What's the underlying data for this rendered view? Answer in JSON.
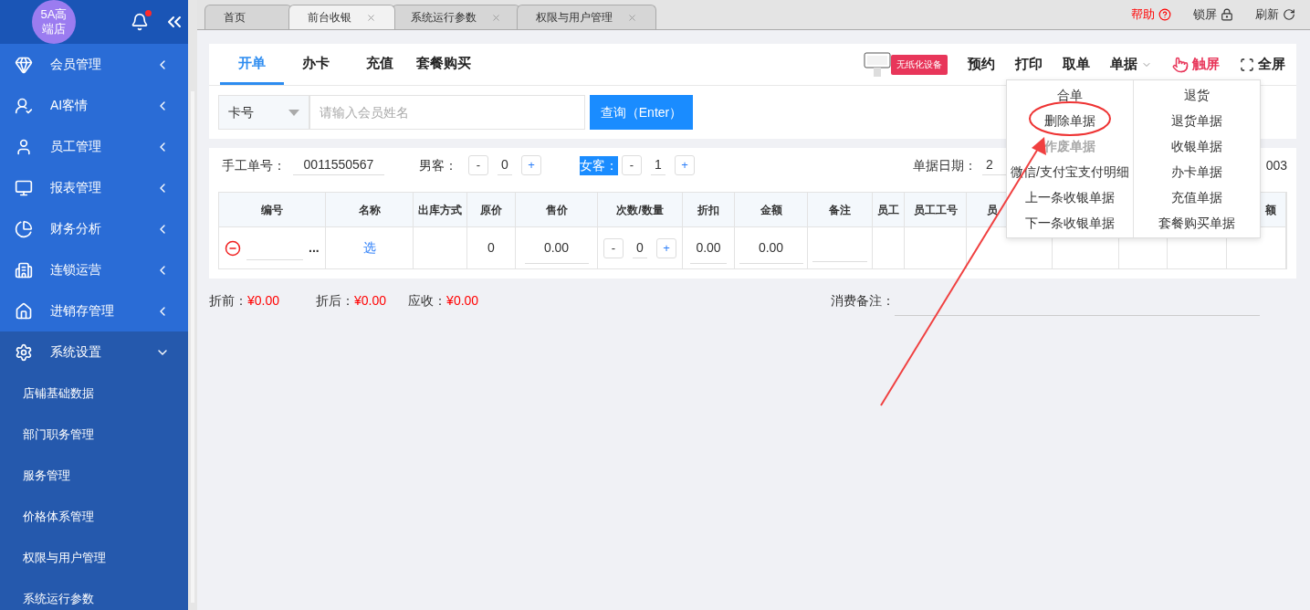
{
  "sidebar": {
    "store_badge": "5A高端店",
    "has_unread": true,
    "items": [
      {
        "label": "会员管理",
        "expanded": false
      },
      {
        "label": "AI客情",
        "expanded": false
      },
      {
        "label": "员工管理",
        "expanded": false
      },
      {
        "label": "报表管理",
        "expanded": false
      },
      {
        "label": "财务分析",
        "expanded": false
      },
      {
        "label": "连锁运营",
        "expanded": false
      },
      {
        "label": "进销存管理",
        "expanded": false
      },
      {
        "label": "系统设置",
        "expanded": true,
        "children": [
          "店铺基础数据",
          "部门职务管理",
          "服务管理",
          "价格体系管理",
          "权限与用户管理",
          "系统运行参数"
        ]
      }
    ]
  },
  "tabs": [
    {
      "label": "首页",
      "selected": false,
      "closable": false
    },
    {
      "label": "前台收银",
      "selected": true,
      "closable": true
    },
    {
      "label": "系统运行参数",
      "selected": false,
      "closable": true
    },
    {
      "label": "权限与用户管理",
      "selected": false,
      "closable": true
    }
  ],
  "header_actions": [
    {
      "label": "帮助",
      "kind": "help"
    },
    {
      "label": "锁屏",
      "kind": "lock"
    },
    {
      "label": "刷新",
      "kind": "refresh"
    }
  ],
  "page_tabs": [
    {
      "label": "开单",
      "selected": true
    },
    {
      "label": "办卡",
      "selected": false
    },
    {
      "label": "充值",
      "selected": false
    },
    {
      "label": "套餐购买",
      "selected": false
    }
  ],
  "paperless_badge": "无纸化设备",
  "toolbar": [
    {
      "label": "预约",
      "kind": "plain"
    },
    {
      "label": "打印",
      "kind": "plain"
    },
    {
      "label": "取单",
      "kind": "plain"
    },
    {
      "label": "单据",
      "kind": "dropdown"
    },
    {
      "label": "触屏",
      "kind": "touch"
    },
    {
      "label": "全屏",
      "kind": "fullscreen"
    }
  ],
  "search": {
    "select_value": "卡号",
    "placeholder": "请输入会员姓名",
    "button": "查询（Enter）"
  },
  "form": {
    "manual_no_label": "手工单号：",
    "manual_no": "0011550567",
    "male_label": "男客：",
    "male_count": "0",
    "female_label": "女客：",
    "female_highlighted": true,
    "female_count": "1",
    "stepper_minus": "-",
    "stepper_plus": "+",
    "date_label": "单据日期：",
    "date_value": "2",
    "trailing_text": "003"
  },
  "table": {
    "columns": [
      "编号",
      "名称",
      "出库方式",
      "原价",
      "售价",
      "次数/数量",
      "折扣",
      "金额",
      "备注",
      "员工",
      "员工工号",
      "员",
      "",
      "",
      "",
      "额"
    ],
    "row": {
      "pick_dots": "...",
      "name_link": "选",
      "original_price": "0",
      "sale_price": "0.00",
      "qty": "0",
      "qty_minus": "-",
      "qty_plus": "+",
      "discount": "0.00",
      "amount": "0.00"
    }
  },
  "totals": [
    {
      "label": "折前：",
      "value": "¥0.00"
    },
    {
      "label": "折后：",
      "value": "¥0.00"
    },
    {
      "label": "应收：",
      "value": "¥0.00"
    }
  ],
  "remark_label": "消费备注：",
  "dropdown": {
    "left": [
      {
        "label": "合单",
        "disabled": false
      },
      {
        "label": "删除单据",
        "disabled": false
      },
      {
        "label": "作废单据",
        "disabled": true
      },
      {
        "label": "微信/支付宝支付明细",
        "disabled": false
      },
      {
        "label": "上一条收银单据",
        "disabled": false
      },
      {
        "label": "下一条收银单据",
        "disabled": false
      }
    ],
    "right": [
      {
        "label": "退货",
        "disabled": false
      },
      {
        "label": "退货单据",
        "disabled": false
      },
      {
        "label": "收银单据",
        "disabled": false
      },
      {
        "label": "办卡单据",
        "disabled": false
      },
      {
        "label": "充值单据",
        "disabled": false
      },
      {
        "label": "套餐购买单据",
        "disabled": false
      }
    ]
  }
}
